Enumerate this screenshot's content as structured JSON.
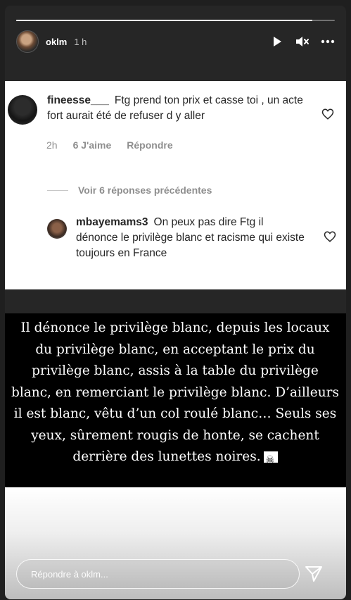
{
  "story": {
    "username": "oklm",
    "time": "1 h",
    "progress_fraction": 0.93
  },
  "icons": {
    "play": "play-icon",
    "mute": "mute-icon",
    "more": "more-icon",
    "heart": "heart-icon",
    "send": "send-icon"
  },
  "comments": [
    {
      "username": "fineesse___",
      "text": "Ftg prend ton prix et casse toi , un acte fort aurait été de refuser d y aller",
      "time": "2h",
      "likes": "6 J'aime",
      "reply": "Répondre"
    },
    {
      "username": "mbayemams3",
      "text": "On peux pas dire Ftg il dénonce le privilège blanc et racisme qui existe toujours en France"
    }
  ],
  "previous_replies": "Voir 6 réponses précédentes",
  "quote": {
    "text": "Il dénonce le privilège blanc, depuis les locaux du privilège blanc, en acceptant le prix du privilège blanc, assis à la table du privilège blanc, en remerciant le privilège blanc. D’ailleurs il est blanc, vêtu d’un col roulé blanc… Seuls ses yeux, sûrement rougis de honte, se cachent derrière des lunettes noires.",
    "emoji": "pirate-flag-icon"
  },
  "reply_input": {
    "placeholder": "Répondre à oklm..."
  }
}
